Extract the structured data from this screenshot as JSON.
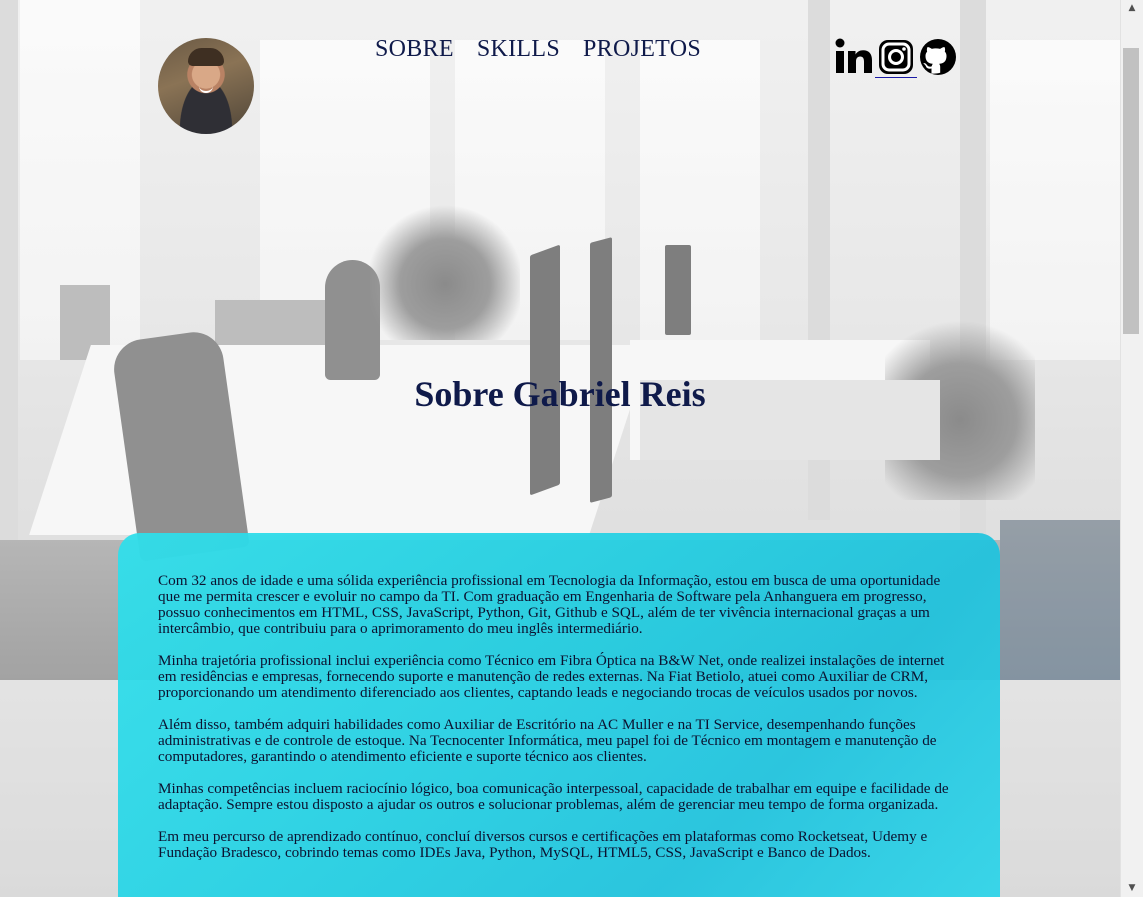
{
  "header": {
    "avatar_alt": "Gabriel Reis",
    "nav": [
      {
        "label": "SOBRE"
      },
      {
        "label": "SKILLS"
      },
      {
        "label": "PROJETOS"
      }
    ],
    "social": [
      {
        "icon": "linkedin-icon"
      },
      {
        "icon": "instagram-icon"
      },
      {
        "icon": "github-icon"
      }
    ]
  },
  "about": {
    "title": "Sobre Gabriel Reis",
    "paragraphs": [
      "Com 32 anos de idade e uma sólida experiência profissional em Tecnologia da Informação, estou em busca de uma oportunidade que me permita crescer e evoluir no campo da TI. Com graduação em Engenharia de Software pela Anhanguera em progresso, possuo conhecimentos em HTML, CSS, JavaScript, Python, Git, Github e SQL, além de ter vivência internacional graças a um intercâmbio, que contribuiu para o aprimoramento do meu inglês intermediário.",
      "Minha trajetória profissional inclui experiência como Técnico em Fibra Óptica na B&W Net, onde realizei instalações de internet em residências e empresas, fornecendo suporte e manutenção de redes externas. Na Fiat Betiolo, atuei como Auxiliar de CRM, proporcionando um atendimento diferenciado aos clientes, captando leads e negociando trocas de veículos usados por novos.",
      "Além disso, também adquiri habilidades como Auxiliar de Escritório na AC Muller e na TI Service, desempenhando funções administrativas e de controle de estoque. Na Tecnocenter Informática, meu papel foi de Técnico em montagem e manutenção de computadores, garantindo o atendimento eficiente e suporte técnico aos clientes.",
      "Minhas competências incluem raciocínio lógico, boa comunicação interpessoal, capacidade de trabalhar em equipe e facilidade de adaptação. Sempre estou disposto a ajudar os outros e solucionar problemas, além de gerenciar meu tempo de forma organizada.",
      "Em meu percurso de aprendizado contínuo, concluí diversos cursos e certificações em plataformas como Rocketseat, Udemy e Fundação Bradesco, cobrindo temas como IDEs Java, Python, MySQL, HTML5, CSS, JavaScript e Banco de Dados."
    ]
  },
  "colors": {
    "nav_text": "#0f1a4a",
    "card_accent": "#22cfe3"
  }
}
